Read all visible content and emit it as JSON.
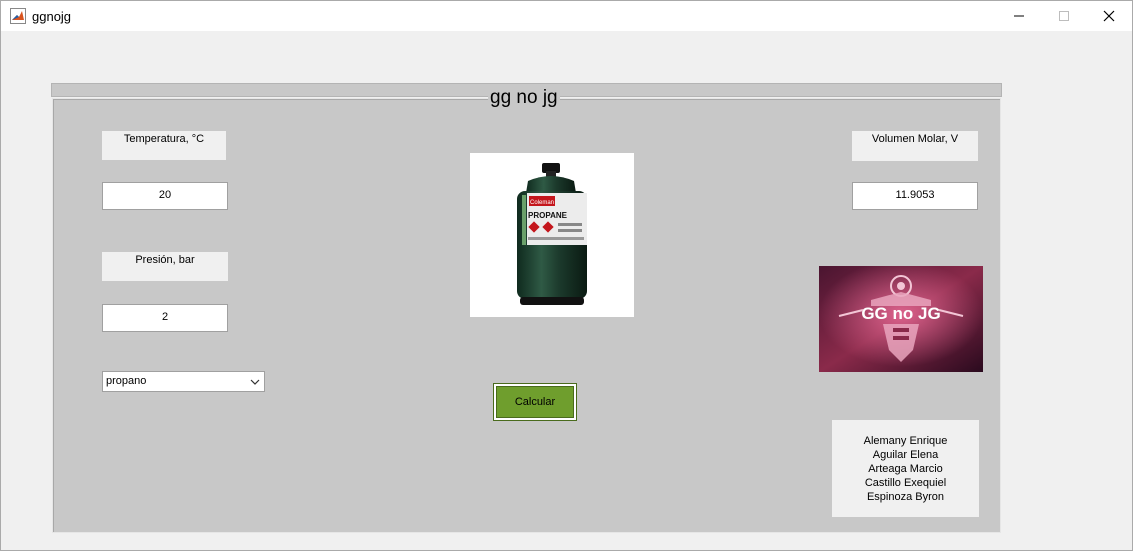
{
  "window": {
    "title": "ggnojg",
    "icon": "matlab-icon",
    "controls": [
      "minimize-icon",
      "maximize-icon",
      "close-icon"
    ]
  },
  "panel": {
    "title": "gg no jg"
  },
  "inputs": {
    "temperature_label": "Temperatura, °C",
    "temperature_value": "20",
    "pressure_label": "Presión, bar",
    "pressure_value": "2",
    "gas_select_value": "propano"
  },
  "output": {
    "molar_volume_label": "Volumen Molar, V",
    "molar_volume_value": "11.9053"
  },
  "images": {
    "canister_label": "PROPANE",
    "canister_brand": "Coleman",
    "logo_text": "GG no JG"
  },
  "buttons": {
    "calculate_label": "Calcular"
  },
  "team": {
    "members": [
      "Alemany  Enrique",
      "Aguilar    Elena",
      "Arteaga    Marcio",
      "Castillo    Exequiel",
      "Espinoza   Byron"
    ]
  },
  "colors": {
    "panel_bg": "#c8c8c8",
    "button_green": "#6f9e2d",
    "window_bg": "#f0f0f0"
  }
}
